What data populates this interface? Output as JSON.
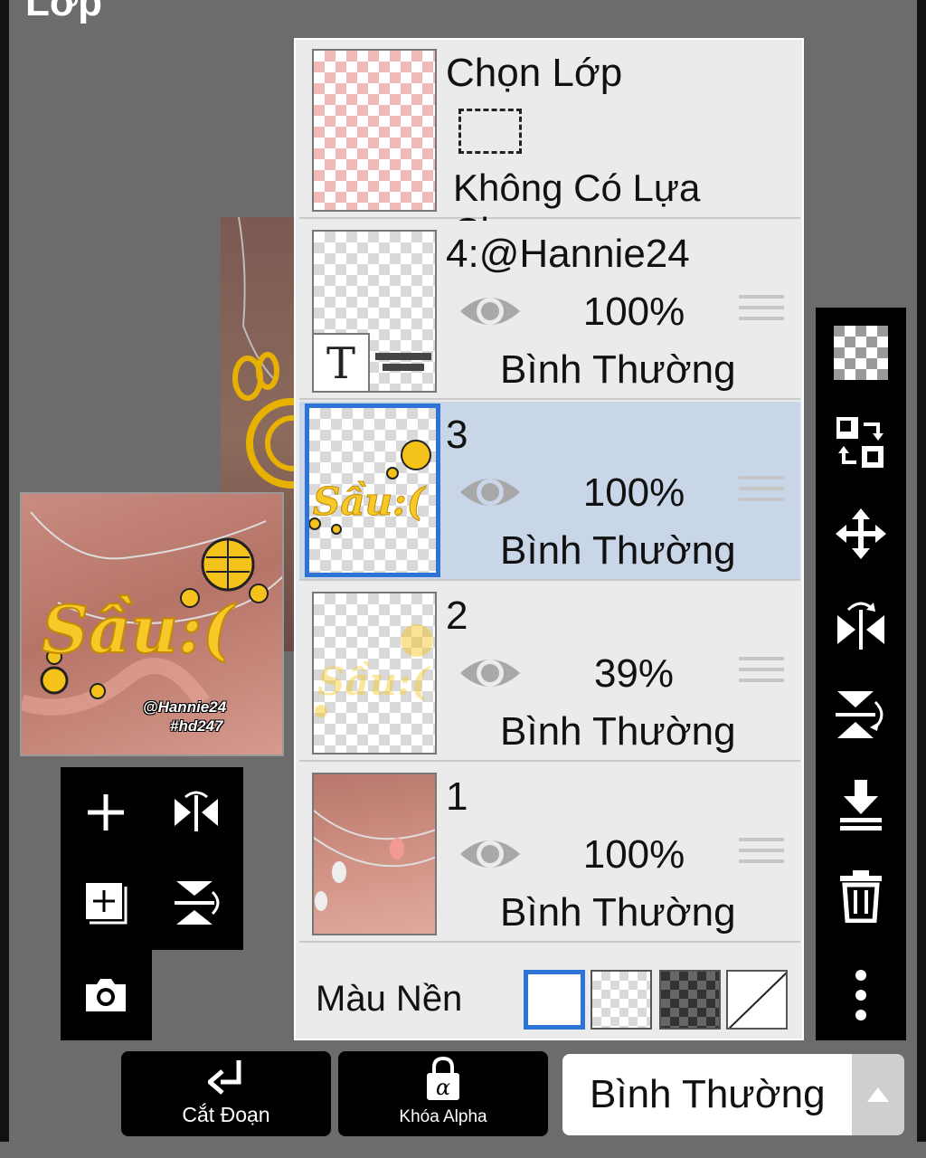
{
  "page": {
    "title": "Lớp"
  },
  "preview": {
    "handle": "@Hannie24",
    "tag": "#hd247"
  },
  "selection_layer": {
    "title": "Chọn Lớp",
    "subtitle": "Không Có Lựa Chọn"
  },
  "layers": [
    {
      "name": "4:@Hannie24",
      "opacity": "100%",
      "blend": "Bình Thường",
      "selected": false,
      "thumb_text": "T"
    },
    {
      "name": "3",
      "opacity": "100%",
      "blend": "Bình Thường",
      "selected": true
    },
    {
      "name": "2",
      "opacity": "39%",
      "blend": "Bình Thường",
      "selected": false
    },
    {
      "name": "1",
      "opacity": "100%",
      "blend": "Bình Thường",
      "selected": false
    }
  ],
  "background": {
    "label": "Màu Nền",
    "selected_swatch": "white"
  },
  "bottom_bar": {
    "clip_label": "Cắt Đoạn",
    "alpha_lock_label": "Khóa Alpha",
    "blend_mode_value": "Bình Thường"
  },
  "colors": {
    "accent": "#2e74d6",
    "selected_row": "#c9d6e8",
    "panel": "#ebebeb",
    "toolbar": "#000000",
    "art_yellow": "#f5c21b"
  },
  "icons": {
    "left_tools": [
      "add-layer-icon",
      "flip-horizontal-icon",
      "duplicate-layer-icon",
      "flip-vertical-icon",
      "camera-icon"
    ],
    "right_tools": [
      "transparent-checker-icon",
      "swap-layer-icon",
      "move-icon",
      "flip-horizontal-icon",
      "flip-vertical-icon",
      "merge-down-icon",
      "trash-icon",
      "more-vertical-icon"
    ]
  }
}
